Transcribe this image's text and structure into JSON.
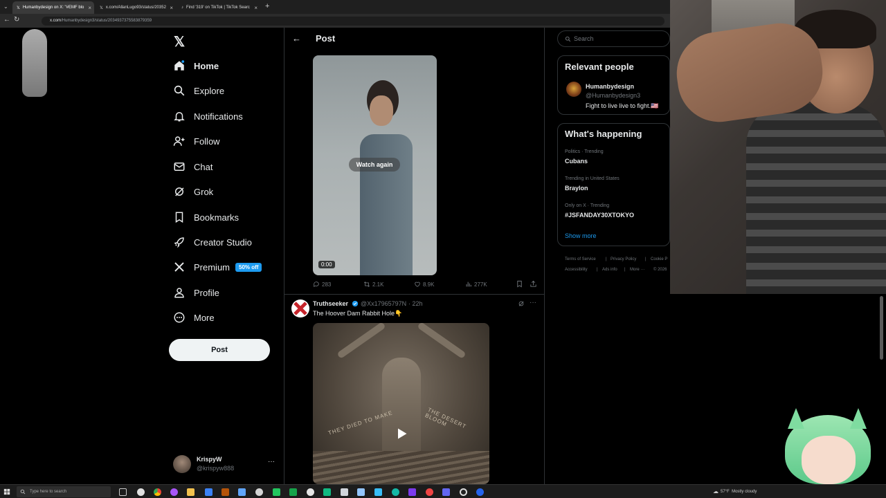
{
  "browser": {
    "tabs": [
      {
        "title": "Humanbydesign on X: \"#EMF blo",
        "active": true
      },
      {
        "title": "x.com/AllanLugo93/status/20352",
        "active": false
      },
      {
        "title": "Find '319' on TikTok | TikTok Searc",
        "active": false
      }
    ],
    "new_tab": "+",
    "url_host": "x.com",
    "url_path": "/Humanbydesign3/status/2034937375583879359"
  },
  "nav": {
    "items": [
      {
        "label": "Home",
        "icon": "home-icon"
      },
      {
        "label": "Explore",
        "icon": "search-icon"
      },
      {
        "label": "Notifications",
        "icon": "bell-icon"
      },
      {
        "label": "Follow",
        "icon": "follow-icon"
      },
      {
        "label": "Chat",
        "icon": "mail-icon"
      },
      {
        "label": "Grok",
        "icon": "grok-icon"
      },
      {
        "label": "Bookmarks",
        "icon": "bookmark-icon"
      },
      {
        "label": "Creator Studio",
        "icon": "rocket-icon"
      },
      {
        "label": "Premium",
        "icon": "x-logo-icon"
      },
      {
        "label": "Profile",
        "icon": "person-icon"
      },
      {
        "label": "More",
        "icon": "more-circle-icon"
      }
    ],
    "premium_badge": "50% off",
    "post_button": "Post",
    "account": {
      "name": "KrispyW",
      "handle": "@krispyw888",
      "menu": "···"
    }
  },
  "main": {
    "header": "Post",
    "video1": {
      "overlay": "Watch again",
      "time": "0:00"
    },
    "metrics": {
      "replies": "283",
      "reposts": "2.1K",
      "likes": "8.9K",
      "views": "277K"
    },
    "reply": {
      "author": "Truthseeker",
      "handle": "@Xx17965797N",
      "time": "· 22h",
      "text": "The Hoover Dam Rabbit Hole👇",
      "engraving_left": "THEY DIED TO MAKE",
      "engraving_right": "THE DESERT BLOOM"
    }
  },
  "sidebar": {
    "search_placeholder": "Search",
    "relevant_title": "Relevant people",
    "person": {
      "name": "Humanbydesign",
      "handle": "@Humanbydesign3",
      "bio": "Fight to live live to fight.🇺🇸"
    },
    "happening_title": "What's happening",
    "trends": [
      {
        "category": "Politics · Trending",
        "name": "Cubans"
      },
      {
        "category": "Trending in United States",
        "name": "Braylon"
      },
      {
        "category": "Only on X · Trending",
        "name": "#JSFANDAY30XTOKYO"
      }
    ],
    "show_more": "Show more",
    "footer": [
      "Terms of Service",
      "|",
      "Privacy Policy",
      "|",
      "Cookie P",
      "Accessibility",
      "|",
      "Ads info",
      "|",
      "More ···",
      "© 2026"
    ]
  },
  "taskbar": {
    "search_placeholder": "Type here to search",
    "weather": "57°F  Mostly cloudy"
  },
  "colors": {
    "accent": "#1d9bf0",
    "background": "#000000",
    "text": "#e7e9ea",
    "muted": "#71767b",
    "border": "#2f3336"
  }
}
